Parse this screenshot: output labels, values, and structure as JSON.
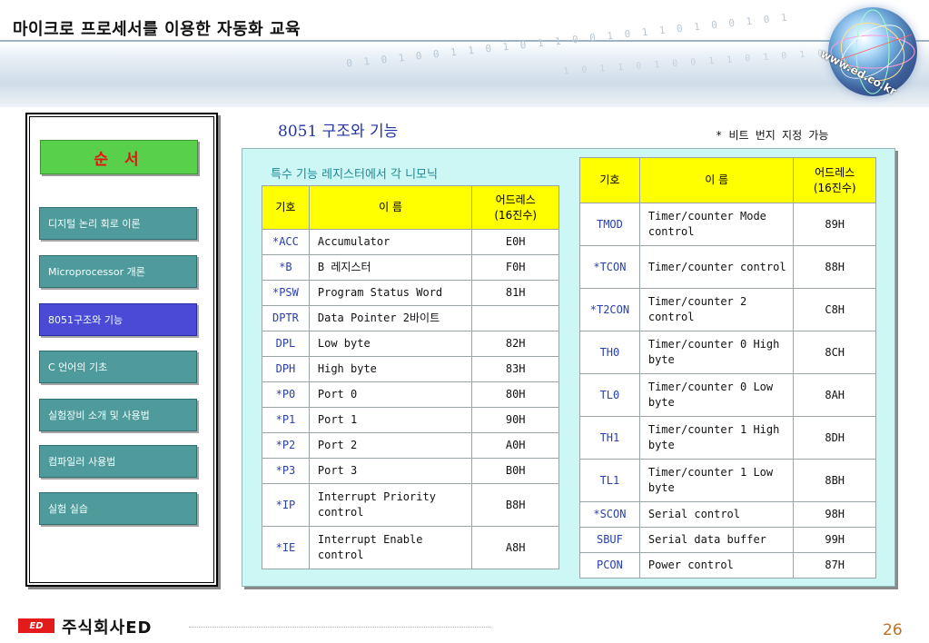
{
  "header": {
    "title": "마이크로 프로세서를 이용한 자동화 교육",
    "globe_url": "www.ed.co.kr"
  },
  "nav": {
    "heading": "순 서",
    "items": [
      {
        "label": "디지털 논리 회로 이론",
        "active": false
      },
      {
        "label": "Microprocessor 개론",
        "active": false
      },
      {
        "label": "8051구조와 기능",
        "active": true
      },
      {
        "label": "C 언어의 기초",
        "active": false
      },
      {
        "label": "실험장비 소개 및 사용법",
        "active": false
      },
      {
        "label": "컴파일러 사용법",
        "active": false
      },
      {
        "label": "실험 실습",
        "active": false
      }
    ]
  },
  "main": {
    "section_title": "8051 구조와 기능",
    "bit_note": "* 비트 번지 지정 가능",
    "subtitle": "특수 기능 레지스터에서 각 니모닉",
    "table_headers": {
      "symbol": "기호",
      "name": "이  름",
      "addr_line1": "어드레스",
      "addr_line2": "(16진수)"
    },
    "left_rows": [
      {
        "sym": "*ACC",
        "name": "Accumulator",
        "addr": "E0H"
      },
      {
        "sym": "*B",
        "name": "B 레지스터",
        "addr": "F0H"
      },
      {
        "sym": "*PSW",
        "name": "Program Status Word",
        "addr": "81H"
      },
      {
        "sym": "DPTR",
        "name": "Data Pointer 2바이트",
        "addr": ""
      },
      {
        "sym": "DPL",
        "name": "Low byte",
        "addr": "82H"
      },
      {
        "sym": "DPH",
        "name": "High byte",
        "addr": "83H"
      },
      {
        "sym": "*P0",
        "name": "Port 0",
        "addr": "80H"
      },
      {
        "sym": "*P1",
        "name": "Port 1",
        "addr": "90H"
      },
      {
        "sym": "*P2",
        "name": "Port 2",
        "addr": "A0H"
      },
      {
        "sym": "*P3",
        "name": "Port 3",
        "addr": "B0H"
      },
      {
        "sym": "*IP",
        "name": "Interrupt Priority control",
        "addr": "B8H"
      },
      {
        "sym": "*IE",
        "name": "Interrupt Enable control",
        "addr": "A8H"
      }
    ],
    "right_rows": [
      {
        "sym": "TMOD",
        "name": "Timer/counter Mode control",
        "addr": "89H"
      },
      {
        "sym": "*TCON",
        "name": "Timer/counter control",
        "addr": "88H"
      },
      {
        "sym": "*T2CON",
        "name": "Timer/counter 2 control",
        "addr": "C8H"
      },
      {
        "sym": "TH0",
        "name": "Timer/counter 0 High byte",
        "addr": "8CH"
      },
      {
        "sym": "TL0",
        "name": "Timer/counter 0 Low byte",
        "addr": "8AH"
      },
      {
        "sym": "TH1",
        "name": "Timer/counter 1 High byte",
        "addr": "8DH"
      },
      {
        "sym": "TL1",
        "name": "Timer/counter 1 Low byte",
        "addr": "8BH"
      },
      {
        "sym": "*SCON",
        "name": "Serial control",
        "addr": "98H"
      },
      {
        "sym": "SBUF",
        "name": "Serial data buffer",
        "addr": "99H"
      },
      {
        "sym": "PCON",
        "name": "Power control",
        "addr": "87H"
      }
    ]
  },
  "footer": {
    "logo_mark": "ED",
    "company": "주식회사ED",
    "page_number": "26"
  },
  "colors": {
    "nav_item": "#4f9b9b",
    "nav_active": "#4a4ad6",
    "nav_heading": "#58d04c",
    "table_header": "#ffff00",
    "panel_bg": "#ccf7f5",
    "symbol_text": "#2940b0"
  }
}
